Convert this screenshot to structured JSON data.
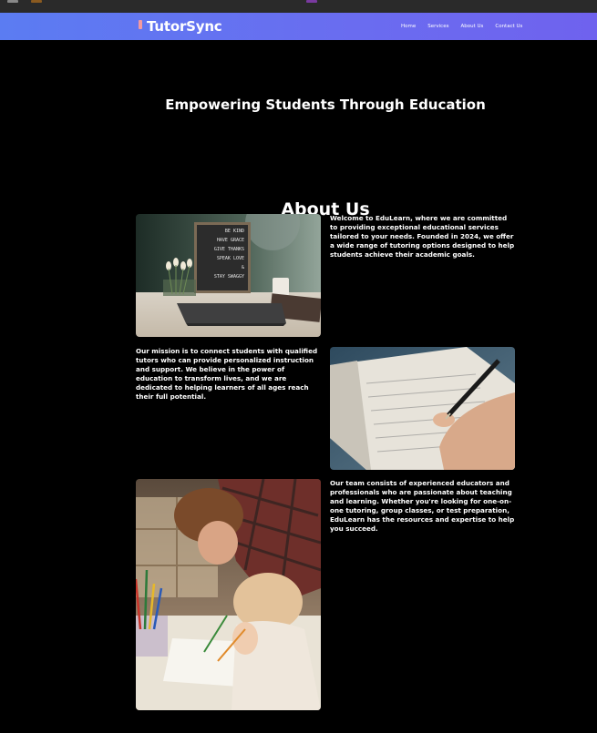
{
  "nav": {
    "brand": "TutorSync",
    "links": [
      "Home",
      "Services",
      "About Us",
      "Contact Us"
    ]
  },
  "hero": {
    "title": "Empowering Students Through Education"
  },
  "about": {
    "title": "About Us",
    "para1": "Welcome to EduLearn, where we are committed to providing exceptional educational services tailored to your needs. Founded in 2024, we offer a wide range of tutoring options designed to help students achieve their academic goals.",
    "para2": "Our mission is to connect students with qualified tutors who can provide personalized instruction and support. We believe in the power of education to transform lives, and we are dedicated to helping learners of all ages reach their full potential.",
    "para3": "Our team consists of experienced educators and professionals who are passionate about teaching and learning. Whether you're looking for one-on-one tutoring, group classes, or test preparation, EduLearn has the resources and expertise to help you succeed.",
    "letterboard": [
      "BE KIND",
      "HAVE GRACE",
      "GIVE THANKS",
      "SPEAK LOVE",
      "&",
      "STAY SWAGGY"
    ]
  },
  "colors": {
    "nav_gradient_start": "#5b7cf2",
    "nav_gradient_end": "#6f62ee",
    "background": "#000000",
    "logo_accent": "#f49aa0"
  }
}
